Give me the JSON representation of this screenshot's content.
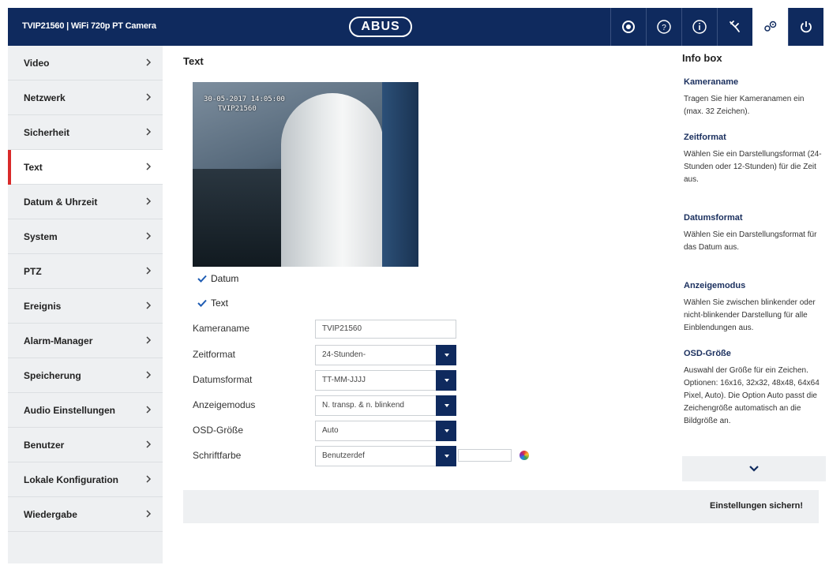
{
  "header": {
    "title": "TVIP21560  |  WiFi 720p PT Camera",
    "logo": "ABUS",
    "icons": [
      "camera-lens-icon",
      "help-icon",
      "info-icon",
      "tools-icon",
      "settings-gears-icon",
      "power-icon"
    ]
  },
  "sidebar": {
    "items": [
      {
        "label": "Video"
      },
      {
        "label": "Netzwerk"
      },
      {
        "label": "Sicherheit"
      },
      {
        "label": "Text",
        "active": true
      },
      {
        "label": "Datum & Uhrzeit"
      },
      {
        "label": "System"
      },
      {
        "label": "PTZ"
      },
      {
        "label": "Ereignis"
      },
      {
        "label": "Alarm-Manager"
      },
      {
        "label": "Speicherung"
      },
      {
        "label": "Audio Einstellungen"
      },
      {
        "label": "Benutzer"
      },
      {
        "label": "Lokale Konfiguration"
      },
      {
        "label": "Wiedergabe"
      }
    ]
  },
  "main": {
    "title": "Text",
    "preview": {
      "osd_date": "30-05-2017 14:05:00",
      "osd_name": "TVIP21560"
    },
    "checkboxes": {
      "datum": {
        "label": "Datum",
        "checked": true
      },
      "text": {
        "label": "Text",
        "checked": true
      }
    },
    "fields": {
      "kameraname": {
        "label": "Kameraname",
        "value": "TVIP21560"
      },
      "zeitformat": {
        "label": "Zeitformat",
        "value": "24-Stunden-"
      },
      "datumsformat": {
        "label": "Datumsformat",
        "value": "TT-MM-JJJJ"
      },
      "anzeigemodus": {
        "label": "Anzeigemodus",
        "value": "N. transp. & n. blinkend"
      },
      "osd_groesse": {
        "label": "OSD-Größe",
        "value": "Auto"
      },
      "schriftfarbe": {
        "label": "Schriftfarbe",
        "value": "Benutzerdef"
      }
    },
    "save_label": "Einstellungen sichern!"
  },
  "infobox": {
    "title": "Info box",
    "sections": [
      {
        "heading": "Kameraname",
        "text": "Tragen Sie hier Kameranamen ein (max. 32 Zeichen)."
      },
      {
        "heading": "Zeitformat",
        "text": "Wählen Sie ein Darstellungsformat (24-Stunden oder 12-Stunden) für die Zeit aus."
      },
      {
        "heading": "Datumsformat",
        "text": "Wählen Sie ein Darstellungsformat für das Datum aus."
      },
      {
        "heading": "Anzeigemodus",
        "text": "Wählen Sie zwischen blinkender oder nicht-blinkender Darstellung für alle Einblendungen aus."
      },
      {
        "heading": "OSD-Größe",
        "text": "Auswahl der Größe für ein Zeichen. Optionen: 16x16, 32x32, 48x48, 64x64 Pixel, Auto). Die Option Auto passt die Zeichengröße automatisch an die Bildgröße an."
      }
    ]
  },
  "colors": {
    "header_bg": "#0f2a5e",
    "active_accent": "#d92a2a",
    "sidebar_bg": "#eef0f2"
  }
}
